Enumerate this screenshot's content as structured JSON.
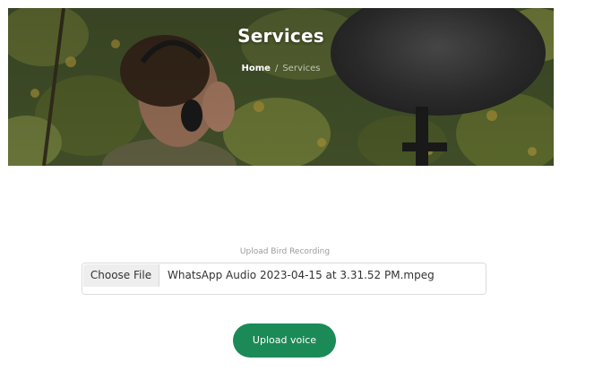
{
  "hero": {
    "title": "Services",
    "breadcrumb": {
      "home": "Home",
      "separator": "/",
      "current": "Services"
    }
  },
  "form": {
    "label": "Upload Bird Recording",
    "file_input": {
      "button_label": "Choose File",
      "file_name": "WhatsApp Audio 2023-04-15 at 3.31.52 PM.mpeg"
    },
    "submit_label": "Upload voice"
  },
  "colors": {
    "accent": "#1b8a57",
    "banner_overlay": "#3b4a28"
  }
}
